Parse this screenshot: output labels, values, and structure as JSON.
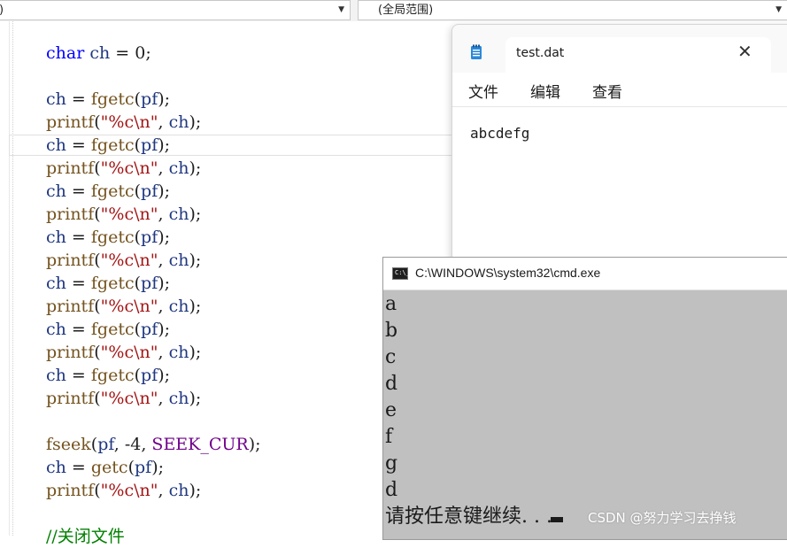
{
  "toolbar": {
    "left_combo_value": ")",
    "right_combo_value": "(全局范围)"
  },
  "editor": {
    "lines": [
      [
        {
          "t": "char",
          "c": "kw"
        },
        {
          "t": " ",
          "c": ""
        },
        {
          "t": "ch",
          "c": "var"
        },
        {
          "t": " = 0;",
          "c": ""
        }
      ],
      [],
      [
        {
          "t": "ch",
          "c": "var"
        },
        {
          "t": " = ",
          "c": ""
        },
        {
          "t": "fgetc",
          "c": "fn"
        },
        {
          "t": "(",
          "c": ""
        },
        {
          "t": "pf",
          "c": "var"
        },
        {
          "t": ");",
          "c": ""
        }
      ],
      [
        {
          "t": "printf",
          "c": "fn"
        },
        {
          "t": "(",
          "c": ""
        },
        {
          "t": "\"%c\\n\"",
          "c": "str"
        },
        {
          "t": ", ",
          "c": ""
        },
        {
          "t": "ch",
          "c": "var"
        },
        {
          "t": ");",
          "c": ""
        }
      ],
      [
        {
          "t": "ch",
          "c": "var"
        },
        {
          "t": " = ",
          "c": ""
        },
        {
          "t": "fgetc",
          "c": "fn"
        },
        {
          "t": "(",
          "c": ""
        },
        {
          "t": "pf",
          "c": "var"
        },
        {
          "t": ");",
          "c": ""
        }
      ],
      [
        {
          "t": "printf",
          "c": "fn"
        },
        {
          "t": "(",
          "c": ""
        },
        {
          "t": "\"%c\\n\"",
          "c": "str"
        },
        {
          "t": ", ",
          "c": ""
        },
        {
          "t": "ch",
          "c": "var"
        },
        {
          "t": ");",
          "c": ""
        }
      ],
      [
        {
          "t": "ch",
          "c": "var"
        },
        {
          "t": " = ",
          "c": ""
        },
        {
          "t": "fgetc",
          "c": "fn"
        },
        {
          "t": "(",
          "c": ""
        },
        {
          "t": "pf",
          "c": "var"
        },
        {
          "t": ");",
          "c": ""
        }
      ],
      [
        {
          "t": "printf",
          "c": "fn"
        },
        {
          "t": "(",
          "c": ""
        },
        {
          "t": "\"%c\\n\"",
          "c": "str"
        },
        {
          "t": ", ",
          "c": ""
        },
        {
          "t": "ch",
          "c": "var"
        },
        {
          "t": ");",
          "c": ""
        }
      ],
      [
        {
          "t": "ch",
          "c": "var"
        },
        {
          "t": " = ",
          "c": ""
        },
        {
          "t": "fgetc",
          "c": "fn"
        },
        {
          "t": "(",
          "c": ""
        },
        {
          "t": "pf",
          "c": "var"
        },
        {
          "t": ");",
          "c": ""
        }
      ],
      [
        {
          "t": "printf",
          "c": "fn"
        },
        {
          "t": "(",
          "c": ""
        },
        {
          "t": "\"%c\\n\"",
          "c": "str"
        },
        {
          "t": ", ",
          "c": ""
        },
        {
          "t": "ch",
          "c": "var"
        },
        {
          "t": ");",
          "c": ""
        }
      ],
      [
        {
          "t": "ch",
          "c": "var"
        },
        {
          "t": " = ",
          "c": ""
        },
        {
          "t": "fgetc",
          "c": "fn"
        },
        {
          "t": "(",
          "c": ""
        },
        {
          "t": "pf",
          "c": "var"
        },
        {
          "t": ");",
          "c": ""
        }
      ],
      [
        {
          "t": "printf",
          "c": "fn"
        },
        {
          "t": "(",
          "c": ""
        },
        {
          "t": "\"%c\\n\"",
          "c": "str"
        },
        {
          "t": ", ",
          "c": ""
        },
        {
          "t": "ch",
          "c": "var"
        },
        {
          "t": ");",
          "c": ""
        }
      ],
      [
        {
          "t": "ch",
          "c": "var"
        },
        {
          "t": " = ",
          "c": ""
        },
        {
          "t": "fgetc",
          "c": "fn"
        },
        {
          "t": "(",
          "c": ""
        },
        {
          "t": "pf",
          "c": "var"
        },
        {
          "t": ");",
          "c": ""
        }
      ],
      [
        {
          "t": "printf",
          "c": "fn"
        },
        {
          "t": "(",
          "c": ""
        },
        {
          "t": "\"%c\\n\"",
          "c": "str"
        },
        {
          "t": ", ",
          "c": ""
        },
        {
          "t": "ch",
          "c": "var"
        },
        {
          "t": ");",
          "c": ""
        }
      ],
      [
        {
          "t": "ch",
          "c": "var"
        },
        {
          "t": " = ",
          "c": ""
        },
        {
          "t": "fgetc",
          "c": "fn"
        },
        {
          "t": "(",
          "c": ""
        },
        {
          "t": "pf",
          "c": "var"
        },
        {
          "t": ");",
          "c": ""
        }
      ],
      [
        {
          "t": "printf",
          "c": "fn"
        },
        {
          "t": "(",
          "c": ""
        },
        {
          "t": "\"%c\\n\"",
          "c": "str"
        },
        {
          "t": ", ",
          "c": ""
        },
        {
          "t": "ch",
          "c": "var"
        },
        {
          "t": ");",
          "c": ""
        }
      ],
      [],
      [
        {
          "t": "fseek",
          "c": "fn"
        },
        {
          "t": "(",
          "c": ""
        },
        {
          "t": "pf",
          "c": "var"
        },
        {
          "t": ", -4, ",
          "c": ""
        },
        {
          "t": "SEEK_CUR",
          "c": "mac"
        },
        {
          "t": ");",
          "c": ""
        }
      ],
      [
        {
          "t": "ch",
          "c": "var"
        },
        {
          "t": " = ",
          "c": ""
        },
        {
          "t": "getc",
          "c": "fn"
        },
        {
          "t": "(",
          "c": ""
        },
        {
          "t": "pf",
          "c": "var"
        },
        {
          "t": ");",
          "c": ""
        }
      ],
      [
        {
          "t": "printf",
          "c": "fn"
        },
        {
          "t": "(",
          "c": ""
        },
        {
          "t": "\"%c\\n\"",
          "c": "str"
        },
        {
          "t": ", ",
          "c": ""
        },
        {
          "t": "ch",
          "c": "var"
        },
        {
          "t": ");",
          "c": ""
        }
      ],
      [],
      [
        {
          "t": "//关闭文件",
          "c": "cmt"
        }
      ]
    ]
  },
  "notepad": {
    "tab_title": "test.dat",
    "close_glyph": "✕",
    "menu": [
      "文件",
      "编辑",
      "查看"
    ],
    "content": "abcdefg"
  },
  "cmd": {
    "title": "C:\\WINDOWS\\system32\\cmd.exe",
    "icon_text": "C:\\_",
    "output": [
      "a",
      "b",
      "c",
      "d",
      "e",
      "f",
      "g",
      "d"
    ],
    "prompt": "请按任意键继续. . ."
  },
  "watermark": "CSDN @努力学习去挣钱",
  "colors": {
    "keyword": "#0000ff",
    "variable": "#1f377f",
    "function": "#74531f",
    "string": "#a31515",
    "macro": "#6f008a",
    "comment": "#008000",
    "cmd_background": "#c0c0c0"
  }
}
